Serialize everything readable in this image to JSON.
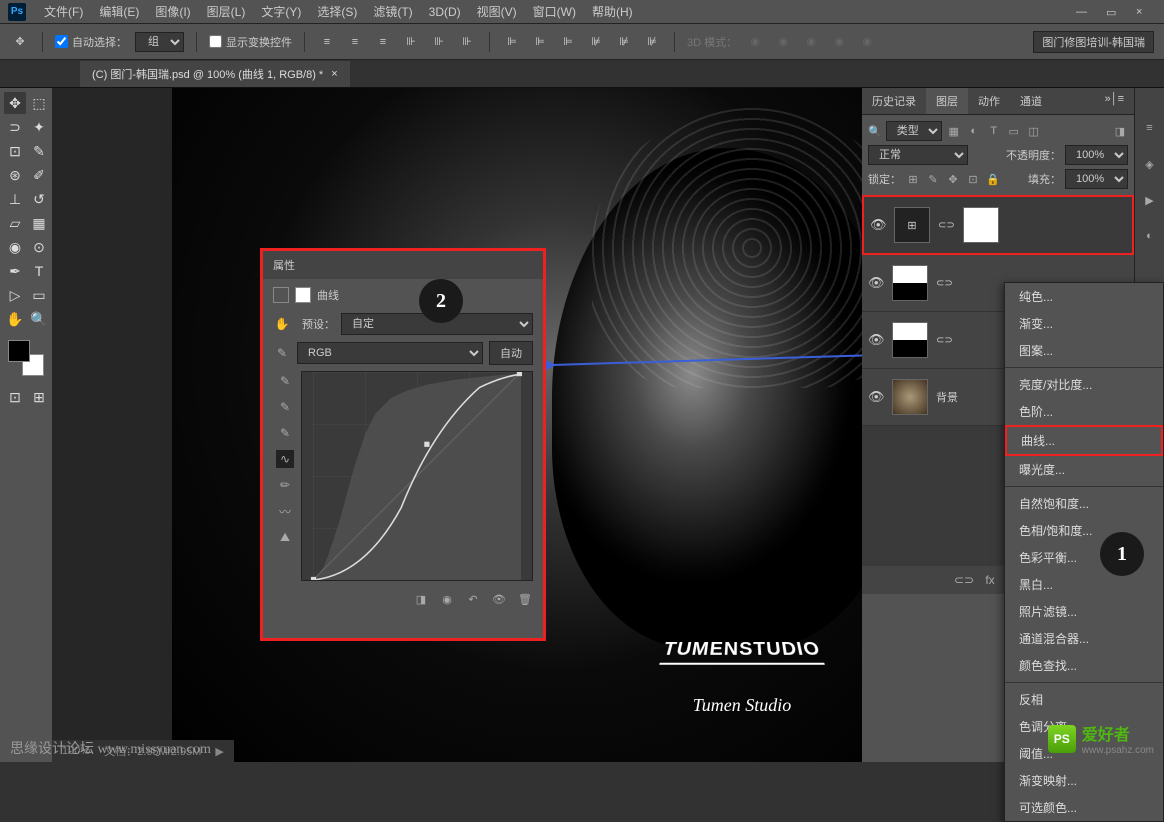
{
  "app": {
    "logo": "Ps"
  },
  "menu": {
    "items": [
      "文件(F)",
      "编辑(E)",
      "图像(I)",
      "图层(L)",
      "文字(Y)",
      "选择(S)",
      "滤镜(T)",
      "3D(D)",
      "视图(V)",
      "窗口(W)",
      "帮助(H)"
    ]
  },
  "window_controls": {
    "min": "—",
    "max": "▭",
    "close": "×"
  },
  "options": {
    "auto_select": "自动选择：",
    "group": "组",
    "show_transform": "显示变换控件",
    "mode_3d": "3D 模式：",
    "project_name": "图门修图培训-韩国瑞"
  },
  "tab": {
    "title": "(C) 图门-韩国瑞.psd @ 100% (曲线 1, RGB/8) *",
    "close": "×"
  },
  "tools": {
    "row": [
      "✥",
      "▭",
      "✥",
      "⬚",
      "⊡",
      "⟋",
      "◔",
      "✎",
      "✒",
      "▭",
      "◐",
      "T",
      "▷",
      "▯",
      "✋",
      "🔍"
    ]
  },
  "properties": {
    "header": "属性",
    "title": "曲线",
    "preset_label": "预设：",
    "preset_value": "自定",
    "channel": "RGB",
    "auto": "自动"
  },
  "annotations": {
    "one": "1",
    "two": "2"
  },
  "panels": {
    "tabs": [
      "历史记录",
      "图层",
      "动作",
      "通道"
    ],
    "active_tab": 1,
    "filter": "类型",
    "blend_mode": "正常",
    "opacity_label": "不透明度：",
    "opacity_value": "100%",
    "lock_label": "锁定：",
    "fill_label": "填充：",
    "fill_value": "100%"
  },
  "layers": [
    {
      "name": "",
      "type": "curves-adj",
      "highlighted": true
    },
    {
      "name": "",
      "type": "levels-adj"
    },
    {
      "name": "",
      "type": "levels-adj"
    },
    {
      "name": "背景",
      "type": "image"
    }
  ],
  "context_menu": {
    "groups": [
      [
        "纯色...",
        "渐变...",
        "图案..."
      ],
      [
        "亮度/对比度...",
        "色阶...",
        "曲线...",
        "曝光度..."
      ],
      [
        "自然饱和度...",
        "色相/饱和度...",
        "色彩平衡...",
        "黑白...",
        "照片滤镜...",
        "通道混合器...",
        "颜色查找..."
      ],
      [
        "反相",
        "色调分离...",
        "阈值...",
        "渐变映射...",
        "可选颜色..."
      ]
    ],
    "highlighted": "曲线..."
  },
  "layers_footer": {
    "icons": [
      "⊂⊃",
      "fx",
      "◻",
      "◐",
      "▣",
      "⊡",
      "▦",
      "🗑"
    ]
  },
  "status": {
    "zoom": "100%",
    "doc_info": "文档：2.95M/2.95M"
  },
  "canvas": {
    "logo_main": "TUMENSTUDIO",
    "logo_sub": "Tumen Studio"
  },
  "watermark": {
    "left": "思缘设计论坛   www.missyuan.com",
    "right_brand": "PS",
    "right_text": "爱好者",
    "right_url": "www.psahz.com"
  }
}
